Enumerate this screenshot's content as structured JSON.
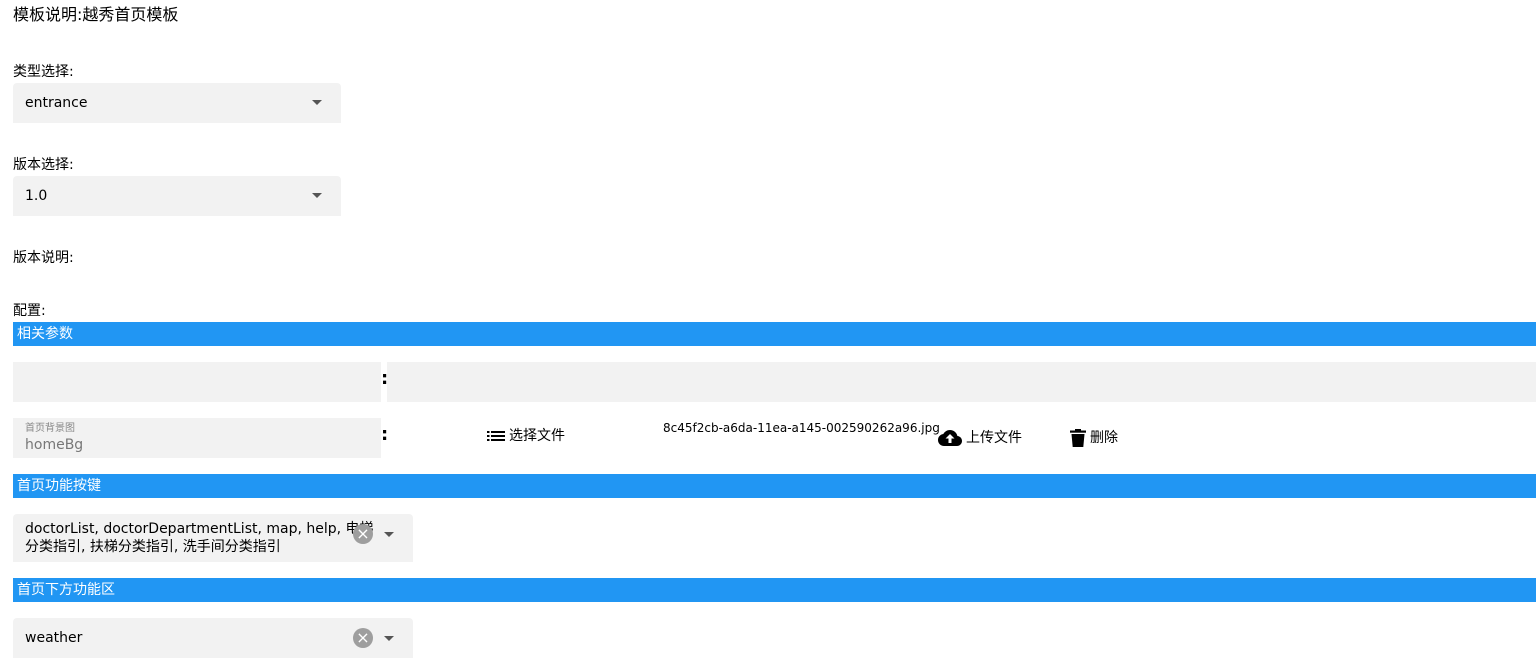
{
  "template_desc": {
    "label": "模板说明:",
    "value": "越秀首页模板"
  },
  "type_select": {
    "label": "类型选择:",
    "value": "entrance"
  },
  "version_select": {
    "label": "版本选择:",
    "value": "1.0"
  },
  "version_desc": {
    "label": "版本说明:"
  },
  "config": {
    "label": "配置:"
  },
  "sections": {
    "params": {
      "title": "相关参数",
      "row1": {
        "key_value": "",
        "separator": ":",
        "value_value": ""
      },
      "row2": {
        "key_float_label": "首页背景图",
        "key_value": "homeBg",
        "separator": ":",
        "choose_file_label": "选择文件",
        "file_name": "8c45f2cb-a6da-11ea-a145-002590262a96.jpg",
        "upload_label": "上传文件",
        "delete_label": "删除"
      }
    },
    "home_buttons": {
      "title": "首页功能按键",
      "value_line1": "doctorList, doctorDepartmentList, map, help, 电梯",
      "value_line2": "分类指引, 扶梯分类指引, 洗手间分类指引"
    },
    "home_bottom": {
      "title": "首页下方功能区",
      "value": "weather"
    }
  },
  "icons": {
    "select_caret": "arrow-drop-down-icon",
    "clear": "cancel-circle-icon",
    "list": "list-icon",
    "upload": "cloud-upload-icon",
    "delete": "trash-icon"
  },
  "colors": {
    "section_bar": "#2196f3",
    "field_bg": "#f2f2f2"
  }
}
